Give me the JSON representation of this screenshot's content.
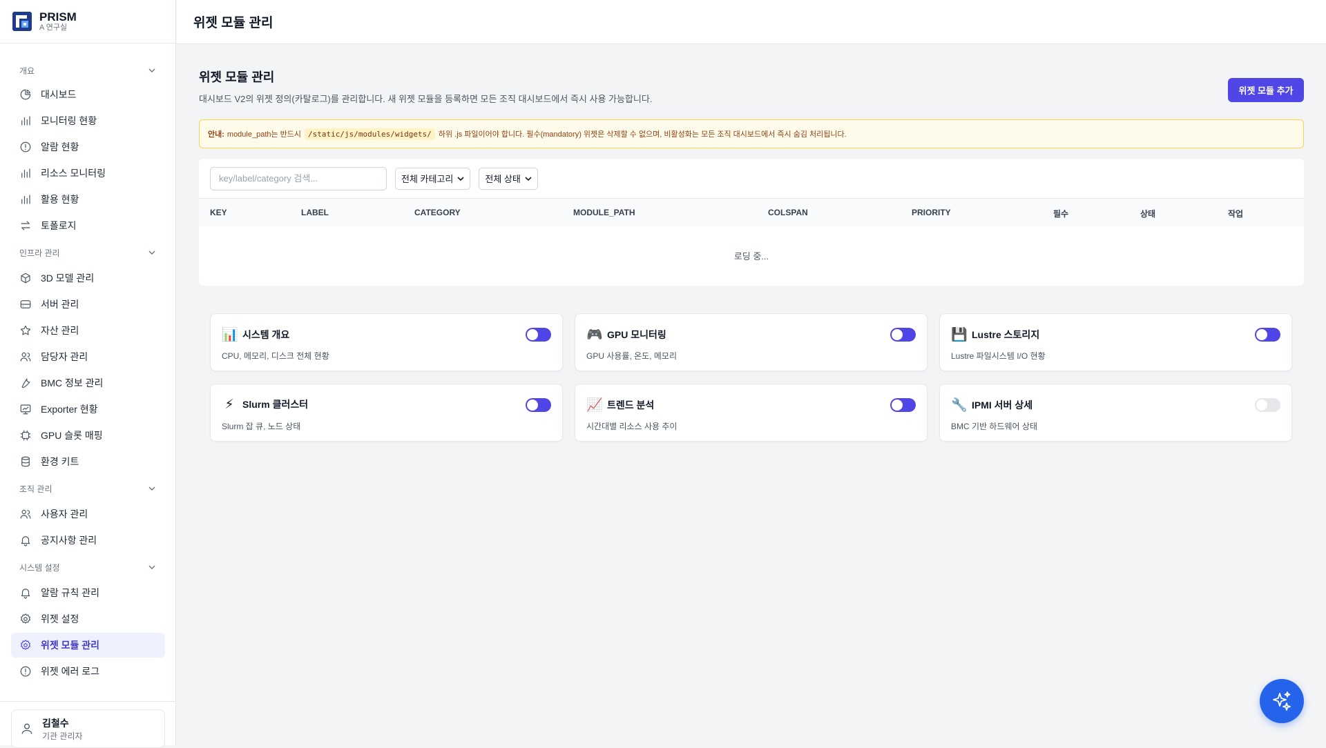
{
  "brand": {
    "name": "PRISM",
    "subtitle": "A 연구실"
  },
  "sidebar": {
    "sections": [
      {
        "label": "개요",
        "items": [
          {
            "label": "대시보드",
            "icon": "pie-chart-icon"
          },
          {
            "label": "모니터링 현황",
            "icon": "bar-chart-icon"
          },
          {
            "label": "알람 현황",
            "icon": "alert-circle-icon"
          },
          {
            "label": "리소스 모니터링",
            "icon": "bar-chart-icon"
          },
          {
            "label": "활용 현황",
            "icon": "bar-chart-icon"
          },
          {
            "label": "토폴로지",
            "icon": "arrows-icon"
          }
        ]
      },
      {
        "label": "인프라 관리",
        "items": [
          {
            "label": "3D 모델 관리",
            "icon": "cube-icon"
          },
          {
            "label": "서버 관리",
            "icon": "server-icon"
          },
          {
            "label": "자산 관리",
            "icon": "star-icon"
          },
          {
            "label": "담당자 관리",
            "icon": "users-icon"
          },
          {
            "label": "BMC 정보 관리",
            "icon": "wrench-icon"
          },
          {
            "label": "Exporter 현황",
            "icon": "monitor-icon"
          },
          {
            "label": "GPU 슬롯 매핑",
            "icon": "chip-icon"
          },
          {
            "label": "환경 키트",
            "icon": "database-icon"
          }
        ]
      },
      {
        "label": "조직 관리",
        "items": [
          {
            "label": "사용자 관리",
            "icon": "users-icon"
          },
          {
            "label": "공지사항 관리",
            "icon": "bell-icon"
          }
        ]
      },
      {
        "label": "시스템 설정",
        "items": [
          {
            "label": "알람 규칙 관리",
            "icon": "bell-icon"
          },
          {
            "label": "위젯 설정",
            "icon": "gear-icon"
          },
          {
            "label": "위젯 모듈 관리",
            "icon": "gear-icon",
            "active": true
          },
          {
            "label": "위젯 에러 로그",
            "icon": "alert-circle-icon"
          }
        ]
      }
    ]
  },
  "user": {
    "name": "김철수",
    "role": "기관 관리자"
  },
  "topbar": {
    "title": "위젯 모듈 관리"
  },
  "page": {
    "title": "위젯 모듈 관리",
    "description": "대시보드 V2의 위젯 정의(카탈로그)를 관리합니다. 새 위젯 모듈을 등록하면 모든 조직 대시보드에서 즉시 사용 가능합니다.",
    "add_button": "위젯 모듈 추가"
  },
  "notice": {
    "label": "안내:",
    "text_before": "module_path는 반드시",
    "code": "/static/js/modules/widgets/",
    "text_after": "하위 .js 파일이어야 합니다. 필수(mandatory) 위젯은 삭제할 수 없으며, 비활성화는 모든 조직 대시보드에서 즉시 숨김 처리됩니다."
  },
  "filters": {
    "search_placeholder": "key/label/category 검색...",
    "category_select": "전체 카테고리",
    "status_select": "전체 상태"
  },
  "table": {
    "columns": [
      "KEY",
      "LABEL",
      "CATEGORY",
      "MODULE_PATH",
      "COLSPAN",
      "PRIORITY",
      "필수",
      "상태",
      "작업"
    ],
    "loading_text": "로딩 중..."
  },
  "widgets": [
    {
      "icon": "📊",
      "title": "시스템 개요",
      "desc": "CPU, 메모리, 디스크 전체 현황",
      "enabled": true
    },
    {
      "icon": "🎮",
      "title": "GPU 모니터링",
      "desc": "GPU 사용률, 온도, 메모리",
      "enabled": true
    },
    {
      "icon": "💾",
      "title": "Lustre 스토리지",
      "desc": "Lustre 파일시스템 I/O 현황",
      "enabled": true
    },
    {
      "icon": "⚡",
      "title": "Slurm 클러스터",
      "desc": "Slurm 잡 큐, 노드 상태",
      "enabled": true
    },
    {
      "icon": "📈",
      "title": "트렌드 분석",
      "desc": "시간대별 리소스 사용 추이",
      "enabled": true
    },
    {
      "icon": "🔧",
      "title": "IPMI 서버 상세",
      "desc": "BMC 기반 하드웨어 상태",
      "enabled": false
    }
  ],
  "colors": {
    "accent": "#4f46e5",
    "fab": "#2563eb",
    "notice_bg": "#fffbeb"
  }
}
